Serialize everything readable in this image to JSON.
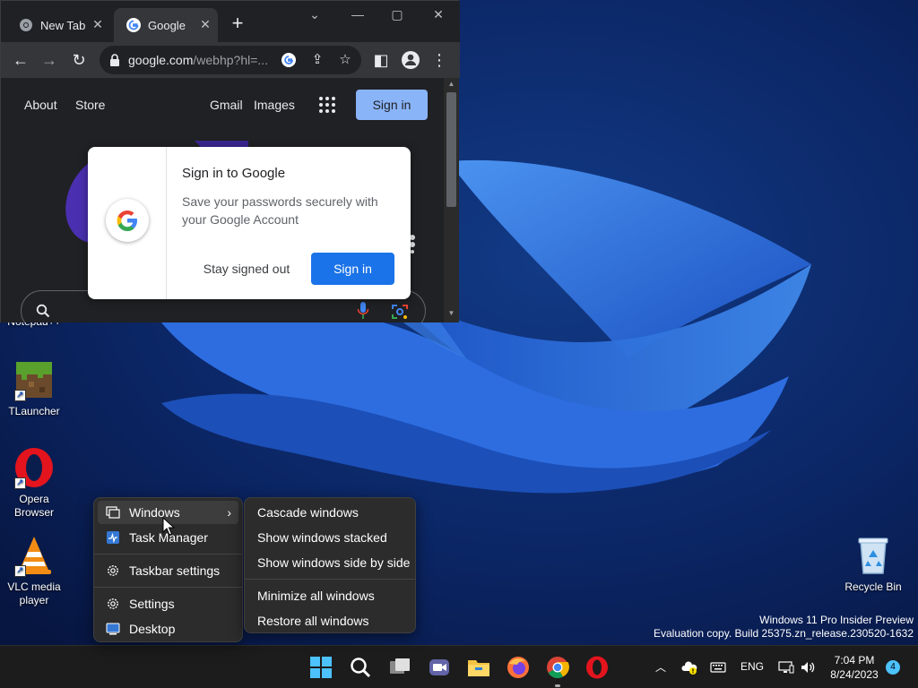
{
  "browser": {
    "tabs": [
      {
        "label": "New Tab",
        "active": false
      },
      {
        "label": "Google",
        "active": true
      }
    ],
    "new_tab_symbol": "+",
    "address": {
      "host": "google.com",
      "path": "/webhp?hl=..."
    },
    "toolbar_icons": [
      "back-icon",
      "forward-icon",
      "reload-icon",
      "lock-icon",
      "google-lens-icon",
      "share-icon",
      "bookmark-star-icon",
      "side-panel-icon",
      "profile-icon",
      "menu-kebab-icon"
    ]
  },
  "google_page": {
    "nav_left": [
      "About",
      "Store"
    ],
    "nav_right": [
      "Gmail",
      "Images"
    ],
    "signin_label": "Sign in"
  },
  "signin_popup": {
    "title": "Sign in to Google",
    "body": "Save your passwords securely with your Google Account",
    "stay_signed_out": "Stay signed out",
    "signin": "Sign in"
  },
  "desktop": {
    "icons": [
      {
        "label": "Notepad++",
        "icon": "notepadpp-icon"
      },
      {
        "label": "TLauncher",
        "icon": "tlauncher-icon"
      },
      {
        "label": "Opera Browser",
        "icon": "opera-icon"
      },
      {
        "label": "VLC media player",
        "icon": "vlc-icon"
      },
      {
        "label": "Recycle Bin",
        "icon": "recycle-bin-icon"
      }
    ],
    "watermark": {
      "line1": "Windows 11 Pro Insider Preview",
      "line2": "Evaluation copy. Build 25375.zn_release.230520-1632"
    }
  },
  "context_menu": {
    "items": [
      {
        "label": "Windows",
        "icon": "windows-icon",
        "has_submenu": true
      },
      {
        "label": "Task Manager",
        "icon": "task-manager-icon"
      },
      {
        "label": "Taskbar settings",
        "icon": "gear-icon"
      },
      {
        "label": "Settings",
        "icon": "gear-icon"
      },
      {
        "label": "Desktop",
        "icon": "desktop-icon"
      }
    ],
    "submenu": [
      "Cascade windows",
      "Show windows stacked",
      "Show windows side by side",
      "Minimize all windows",
      "Restore all windows"
    ]
  },
  "taskbar": {
    "apps": [
      "start-icon",
      "search-icon",
      "task-view-icon",
      "teams-icon",
      "file-explorer-icon",
      "firefox-icon",
      "chrome-icon",
      "opera-icon"
    ],
    "tray": {
      "language": "ENG",
      "time": "7:04 PM",
      "date": "8/24/2023",
      "notification_count": "4"
    }
  },
  "colors": {
    "accent_blue": "#1a73e8",
    "chrome_dark": "#202124",
    "wallpaper": "#0a1e4e"
  }
}
